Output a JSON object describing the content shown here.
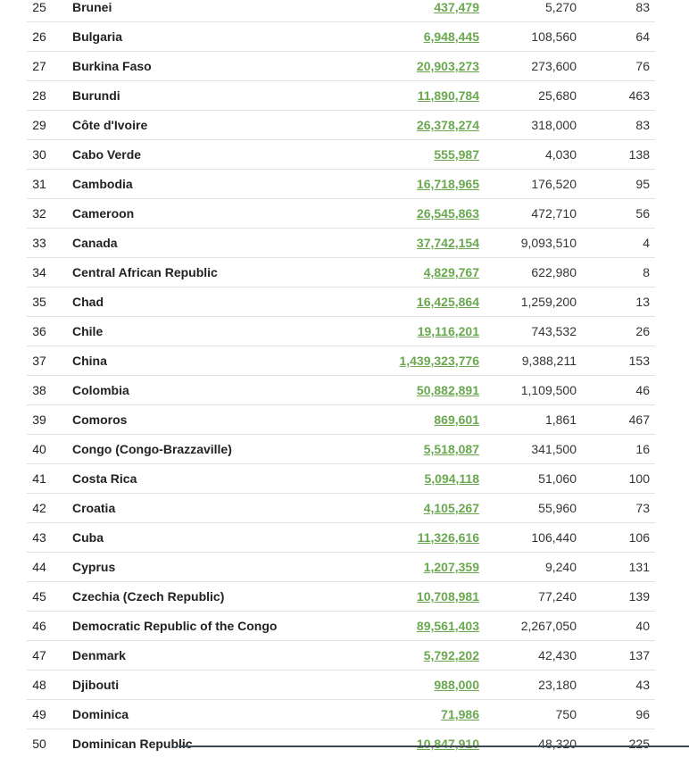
{
  "rows": [
    {
      "rank": "25",
      "country": "Brunei",
      "population": "437,479",
      "area": "5,270",
      "density": "83"
    },
    {
      "rank": "26",
      "country": "Bulgaria",
      "population": "6,948,445",
      "area": "108,560",
      "density": "64"
    },
    {
      "rank": "27",
      "country": "Burkina Faso",
      "population": "20,903,273",
      "area": "273,600",
      "density": "76"
    },
    {
      "rank": "28",
      "country": "Burundi",
      "population": "11,890,784",
      "area": "25,680",
      "density": "463"
    },
    {
      "rank": "29",
      "country": "Côte d'Ivoire",
      "population": "26,378,274",
      "area": "318,000",
      "density": "83"
    },
    {
      "rank": "30",
      "country": "Cabo Verde",
      "population": "555,987",
      "area": "4,030",
      "density": "138"
    },
    {
      "rank": "31",
      "country": "Cambodia",
      "population": "16,718,965",
      "area": "176,520",
      "density": "95"
    },
    {
      "rank": "32",
      "country": "Cameroon",
      "population": "26,545,863",
      "area": "472,710",
      "density": "56"
    },
    {
      "rank": "33",
      "country": "Canada",
      "population": "37,742,154",
      "area": "9,093,510",
      "density": "4"
    },
    {
      "rank": "34",
      "country": "Central African Republic",
      "population": "4,829,767",
      "area": "622,980",
      "density": "8"
    },
    {
      "rank": "35",
      "country": "Chad",
      "population": "16,425,864",
      "area": "1,259,200",
      "density": "13"
    },
    {
      "rank": "36",
      "country": "Chile",
      "population": "19,116,201",
      "area": "743,532",
      "density": "26"
    },
    {
      "rank": "37",
      "country": "China",
      "population": "1,439,323,776",
      "area": "9,388,211",
      "density": "153"
    },
    {
      "rank": "38",
      "country": "Colombia",
      "population": "50,882,891",
      "area": "1,109,500",
      "density": "46"
    },
    {
      "rank": "39",
      "country": "Comoros",
      "population": "869,601",
      "area": "1,861",
      "density": "467"
    },
    {
      "rank": "40",
      "country": "Congo (Congo-Brazzaville)",
      "population": "5,518,087",
      "area": "341,500",
      "density": "16"
    },
    {
      "rank": "41",
      "country": "Costa Rica",
      "population": "5,094,118",
      "area": "51,060",
      "density": "100"
    },
    {
      "rank": "42",
      "country": "Croatia",
      "population": "4,105,267",
      "area": "55,960",
      "density": "73"
    },
    {
      "rank": "43",
      "country": "Cuba",
      "population": "11,326,616",
      "area": "106,440",
      "density": "106"
    },
    {
      "rank": "44",
      "country": "Cyprus",
      "population": "1,207,359",
      "area": "9,240",
      "density": "131"
    },
    {
      "rank": "45",
      "country": "Czechia (Czech Republic)",
      "population": "10,708,981",
      "area": "77,240",
      "density": "139"
    },
    {
      "rank": "46",
      "country": "Democratic Republic of the Congo",
      "population": "89,561,403",
      "area": "2,267,050",
      "density": "40"
    },
    {
      "rank": "47",
      "country": "Denmark",
      "population": "5,792,202",
      "area": "42,430",
      "density": "137"
    },
    {
      "rank": "48",
      "country": "Djibouti",
      "population": "988,000",
      "area": "23,180",
      "density": "43"
    },
    {
      "rank": "49",
      "country": "Dominica",
      "population": "71,986",
      "area": "750",
      "density": "96"
    },
    {
      "rank": "50",
      "country": "Dominican Republic",
      "population": "10,847,910",
      "area": "48,320",
      "density": "225"
    }
  ],
  "colors": {
    "population_link": "#6aa84f",
    "row_border": "#e1e1e1",
    "text": "#222222"
  }
}
